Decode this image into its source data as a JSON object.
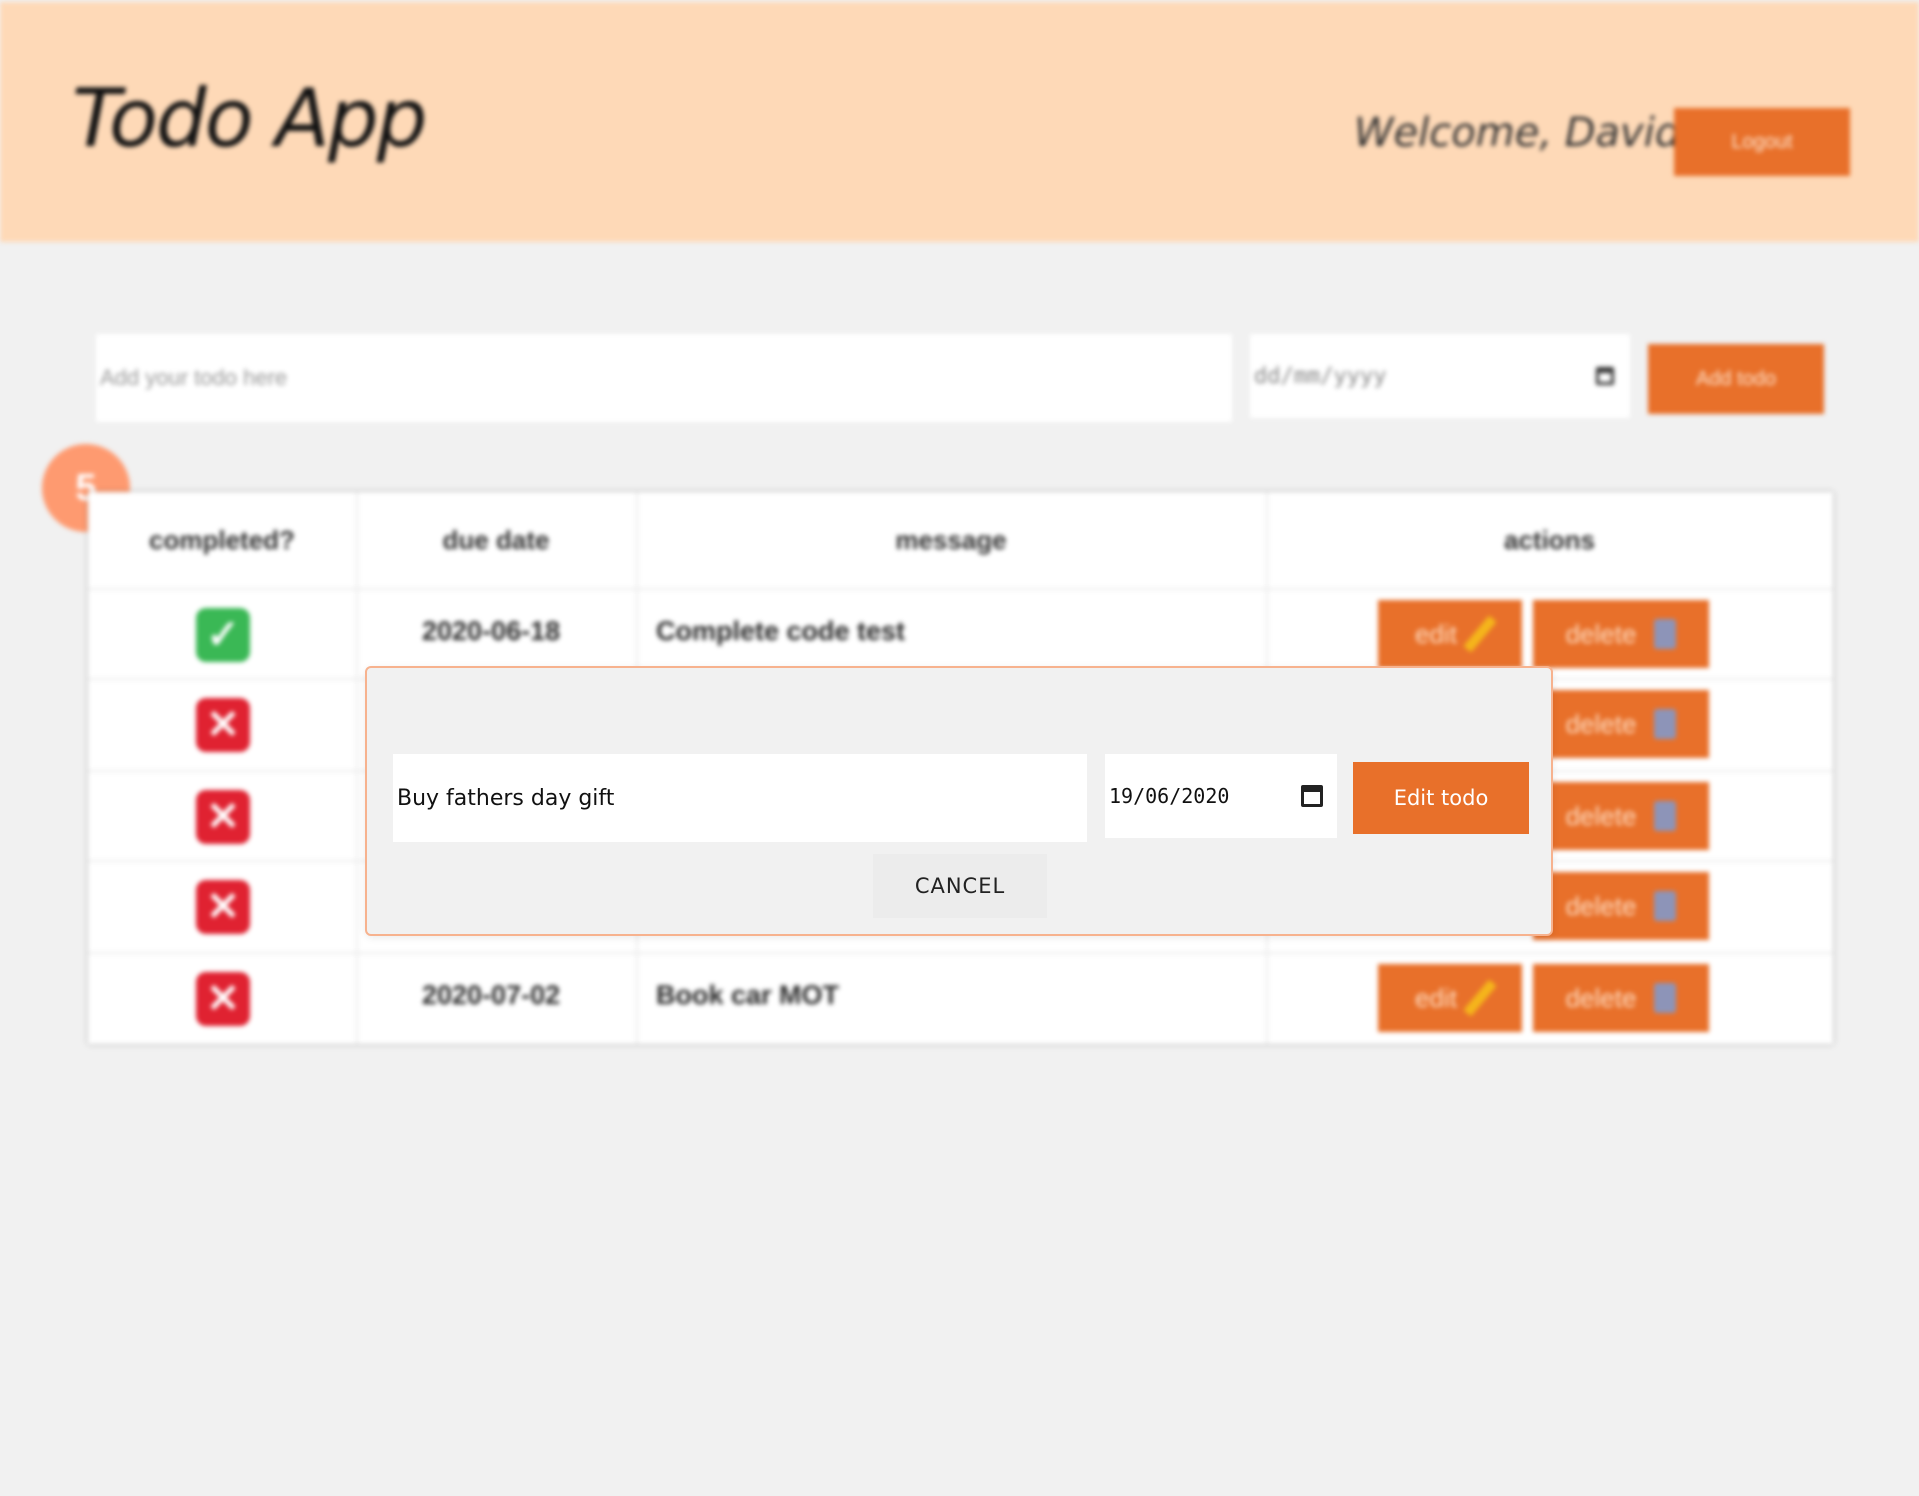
{
  "header": {
    "title": "Todo App",
    "welcome": "Welcome, David",
    "logout_label": "Logout"
  },
  "add_form": {
    "todo_placeholder": "Add your todo here",
    "date_placeholder": "dd/mm/yyyy",
    "add_label": "Add todo"
  },
  "todo_count": "5",
  "table": {
    "headers": [
      "completed?",
      "due date",
      "message",
      "actions"
    ],
    "rows": [
      {
        "completed": true,
        "due_date": "2020-06-18",
        "message": "Complete code test"
      },
      {
        "completed": false,
        "due_date": "",
        "message": ""
      },
      {
        "completed": false,
        "due_date": "",
        "message": ""
      },
      {
        "completed": false,
        "due_date": "",
        "message": ""
      },
      {
        "completed": false,
        "due_date": "2020-07-02",
        "message": "Book car MOT"
      }
    ],
    "edit_label": "edit",
    "delete_label": "delete"
  },
  "modal": {
    "todo_value": "Buy fathers day gift",
    "date_value": "19/06/2020",
    "edit_label": "Edit todo",
    "cancel_label": "CANCEL"
  },
  "colors": {
    "accent": "#e8702a",
    "header_bg": "#fed9b7",
    "badge": "#fe9a70",
    "check_ok": "#3ab855",
    "check_no": "#e02231"
  },
  "icons": {
    "check": "✓",
    "cross": "✕"
  }
}
